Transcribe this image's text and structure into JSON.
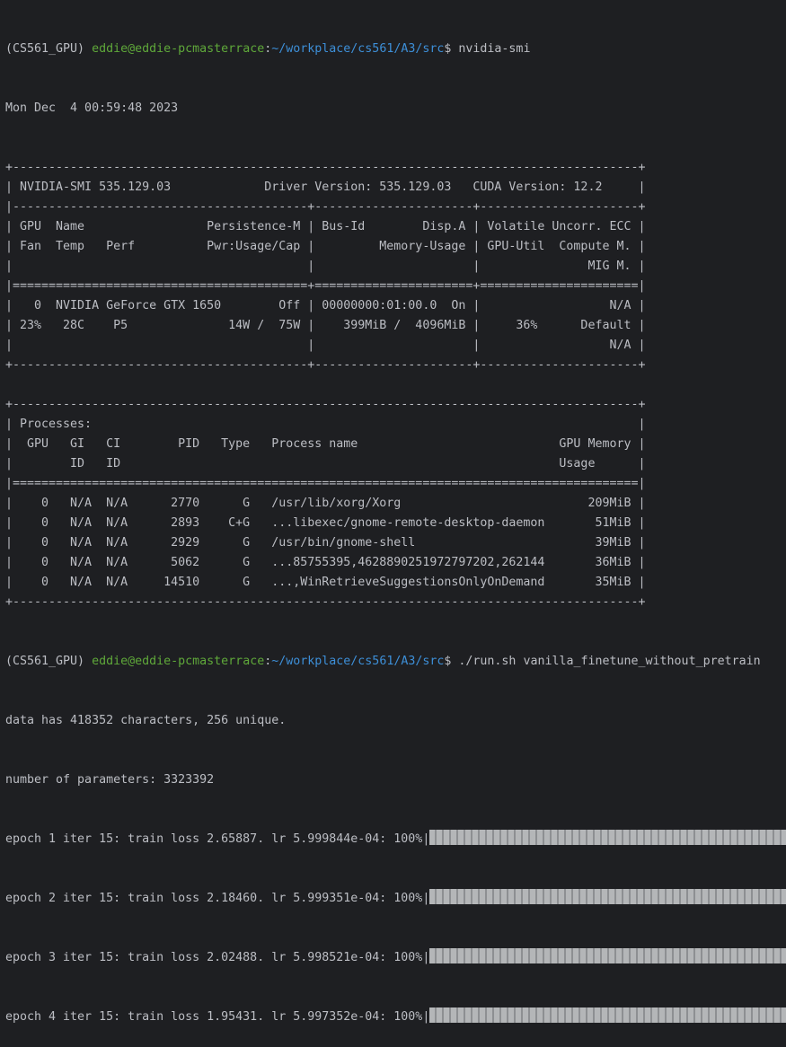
{
  "colors": {
    "background": "#1e1f22",
    "text": "#bcbec4",
    "user_host": "#5fa83a",
    "path": "#3d8fd8",
    "progress": "#b4b6b8"
  },
  "prompt1": {
    "env": "(CS561_GPU) ",
    "user_host": "eddie@eddie-pcmasterrace",
    "sep": ":",
    "path": "~/workplace/cs561/A3/src",
    "dollar": "$ ",
    "command": "nvidia-smi"
  },
  "date": "Mon Dec  4 00:59:48 2023",
  "smi_lines": [
    "+---------------------------------------------------------------------------------------+",
    "| NVIDIA-SMI 535.129.03             Driver Version: 535.129.03   CUDA Version: 12.2     |",
    "|-----------------------------------------+----------------------+----------------------+",
    "| GPU  Name                 Persistence-M | Bus-Id        Disp.A | Volatile Uncorr. ECC |",
    "| Fan  Temp   Perf          Pwr:Usage/Cap |         Memory-Usage | GPU-Util  Compute M. |",
    "|                                         |                      |               MIG M. |",
    "|=========================================+======================+======================|",
    "|   0  NVIDIA GeForce GTX 1650        Off | 00000000:01:00.0  On |                  N/A |",
    "| 23%   28C    P5              14W /  75W |    399MiB /  4096MiB |     36%      Default |",
    "|                                         |                      |                  N/A |",
    "+-----------------------------------------+----------------------+----------------------+",
    "",
    "+---------------------------------------------------------------------------------------+",
    "| Processes:                                                                            |",
    "|  GPU   GI   CI        PID   Type   Process name                            GPU Memory |",
    "|        ID   ID                                                             Usage      |",
    "|=======================================================================================|",
    "|    0   N/A  N/A      2770      G   /usr/lib/xorg/Xorg                          209MiB |",
    "|    0   N/A  N/A      2893    C+G   ...libexec/gnome-remote-desktop-daemon       51MiB |",
    "|    0   N/A  N/A      2929      G   /usr/bin/gnome-shell                         39MiB |",
    "|    0   N/A  N/A      5062      G   ...85755395,4628890251972797202,262144       36MiB |",
    "|    0   N/A  N/A     14510      G   ...,WinRetrieveSuggestionsOnlyOnDemand       35MiB |",
    "+---------------------------------------------------------------------------------------+"
  ],
  "prompt2": {
    "env": "(CS561_GPU) ",
    "user_host": "eddie@eddie-pcmasterrace",
    "sep": ":",
    "path": "~/workplace/cs561/A3/src",
    "dollar": "$ ",
    "command": "./run.sh vanilla_finetune_without_pretrain"
  },
  "output": [
    "data has 418352 characters, 256 unique.",
    "number of parameters: 3323392"
  ],
  "epochs": [
    {
      "text": "epoch 1 iter 15: train loss 2.65887. lr 5.999844e-04: 100%|",
      "progress": 100
    },
    {
      "text": "epoch 2 iter 15: train loss 2.18460. lr 5.999351e-04: 100%|",
      "progress": 100
    },
    {
      "text": "epoch 3 iter 15: train loss 2.02488. lr 5.998521e-04: 100%|",
      "progress": 100
    },
    {
      "text": "epoch 4 iter 15: train loss 1.95431. lr 5.997352e-04: 100%|",
      "progress": 100
    }
  ]
}
